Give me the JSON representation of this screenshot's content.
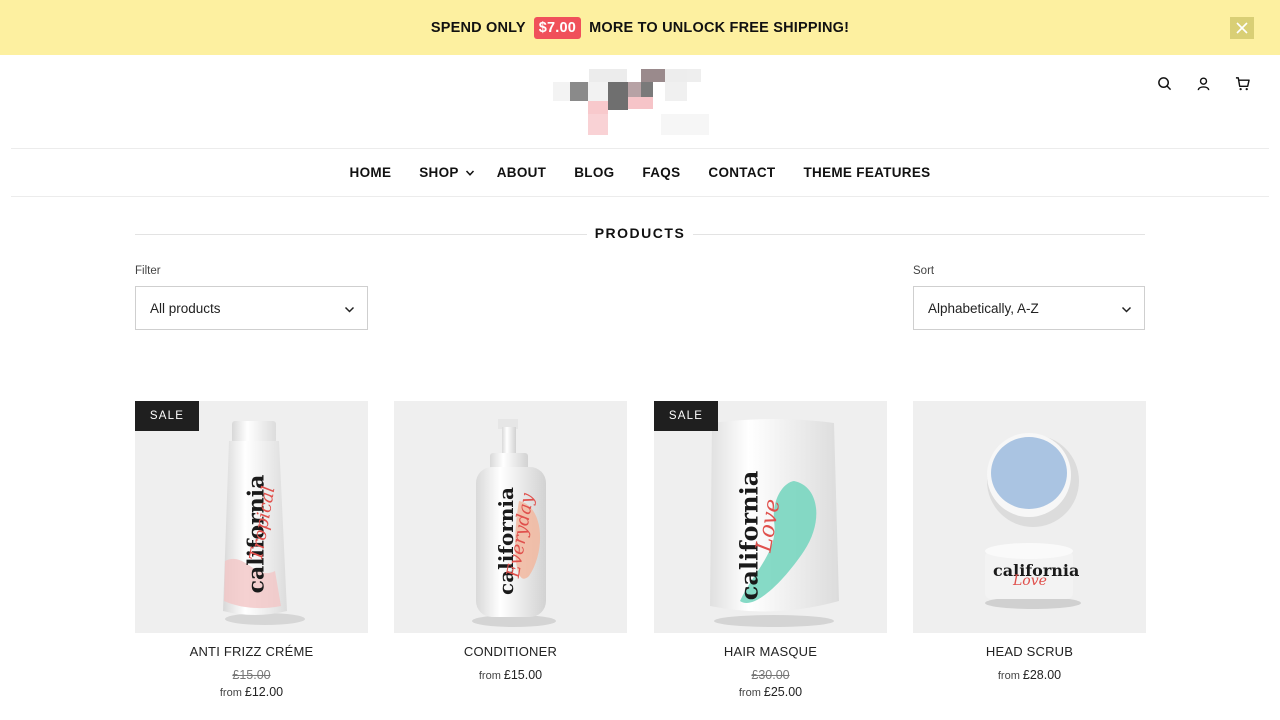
{
  "announcement": {
    "prefix": "SPEND ONLY",
    "amount": "$7.00",
    "suffix": "MORE TO UNLOCK FREE SHIPPING!"
  },
  "header_icons": [
    "search-icon",
    "account-icon",
    "cart-icon"
  ],
  "nav": {
    "items": [
      {
        "label": "HOME"
      },
      {
        "label": "SHOP",
        "has_dropdown": true
      },
      {
        "label": "ABOUT"
      },
      {
        "label": "BLOG"
      },
      {
        "label": "FAQS"
      },
      {
        "label": "CONTACT"
      },
      {
        "label": "THEME FEATURES"
      }
    ]
  },
  "page": {
    "title": "PRODUCTS"
  },
  "filter": {
    "label": "Filter",
    "value": "All products"
  },
  "sort": {
    "label": "Sort",
    "value": "Alphabetically, A-Z"
  },
  "products": [
    {
      "name": "ANTI FRIZZ CRÉME",
      "badge": "SALE",
      "old_price": "£15.00",
      "price_prefix": "from",
      "price": "£12.00",
      "brand": "california",
      "script": "Tropical"
    },
    {
      "name": "CONDITIONER",
      "badge": "",
      "old_price": "",
      "price_prefix": "from",
      "price": "£15.00",
      "brand": "california",
      "script": "Everyday"
    },
    {
      "name": "HAIR MASQUE",
      "badge": "SALE",
      "old_price": "£30.00",
      "price_prefix": "from",
      "price": "£25.00",
      "brand": "california",
      "script": "Love"
    },
    {
      "name": "HEAD SCRUB",
      "badge": "",
      "old_price": "",
      "price_prefix": "from",
      "price": "£28.00",
      "brand": "california",
      "script": "Love"
    }
  ],
  "colors": {
    "announcement_bg": "#fdf0a0",
    "amount_badge": "#f0505a",
    "sale_badge": "#1f1f1f",
    "image_bg": "#efefef"
  }
}
